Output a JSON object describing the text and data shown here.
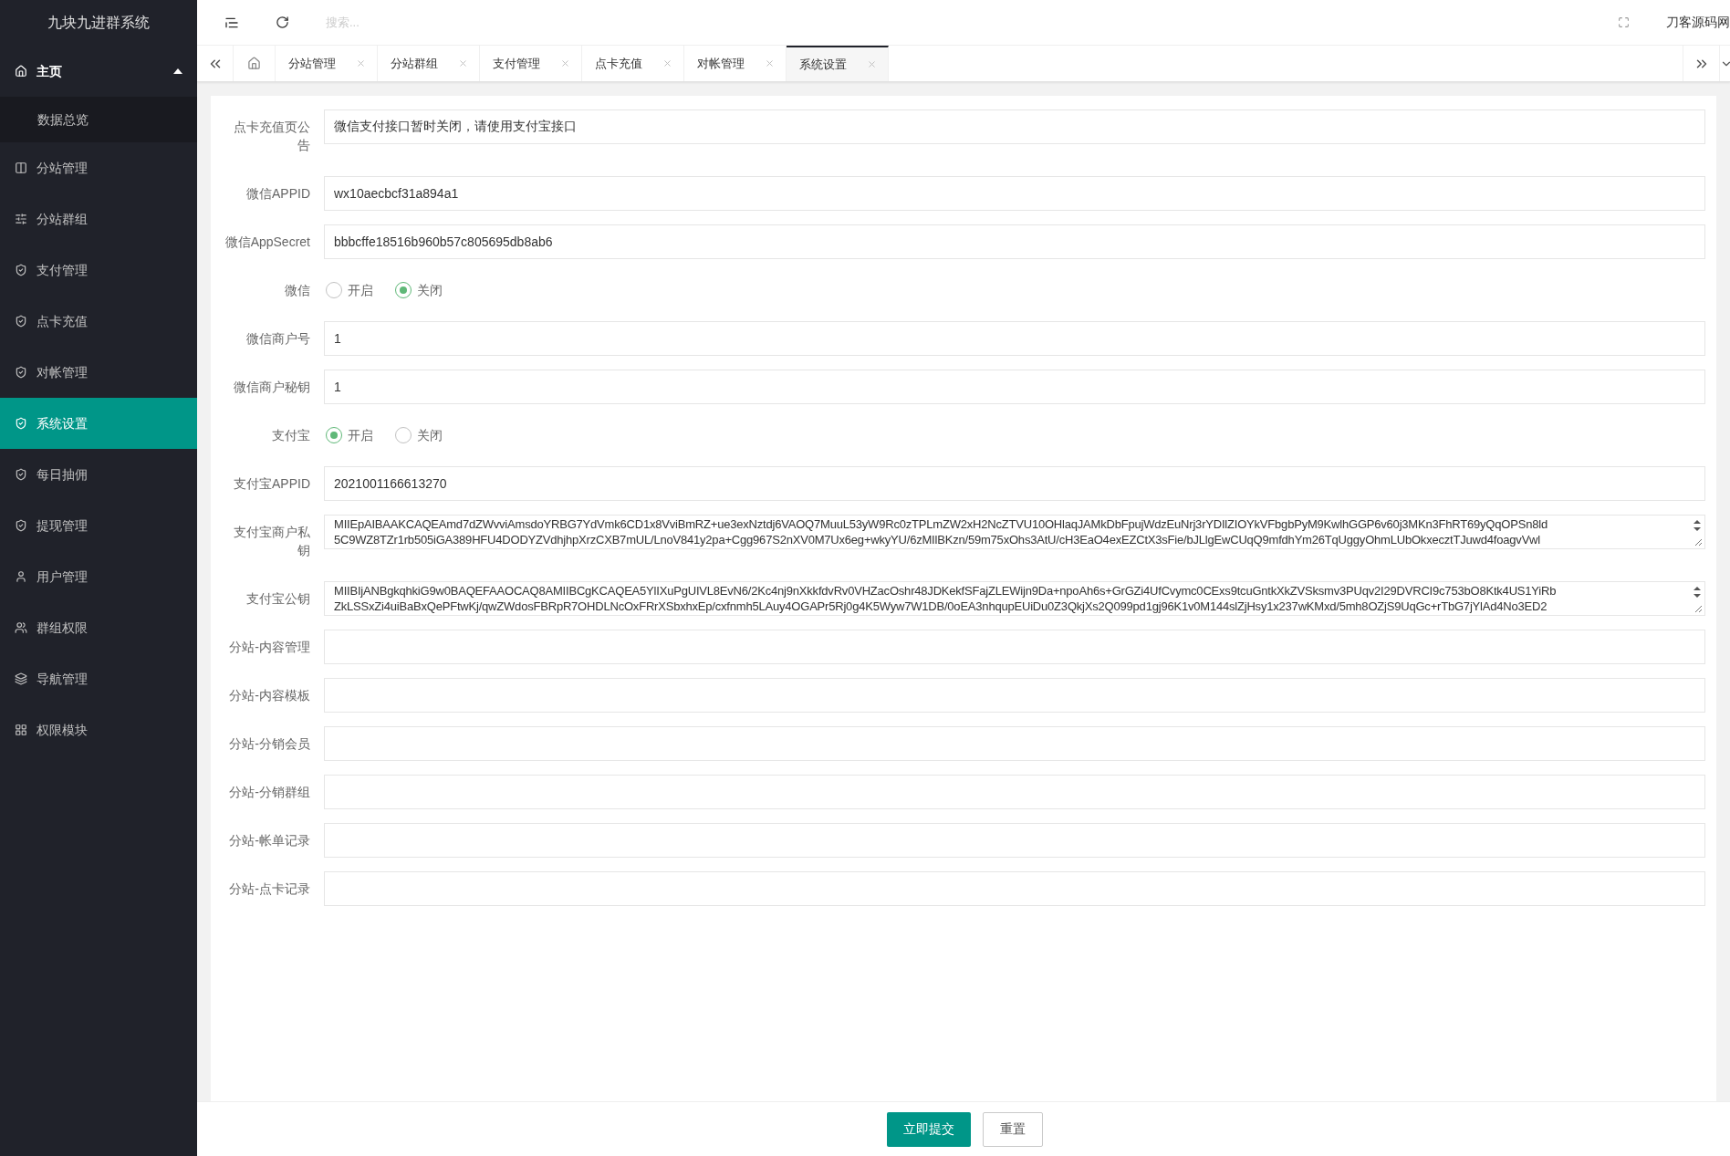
{
  "app_title": "九块九进群系统",
  "sidebar": {
    "items": [
      {
        "label": "主页",
        "expanded": true,
        "selected": false,
        "children": [
          {
            "label": "数据总览",
            "selected": false
          }
        ]
      },
      {
        "label": "分站管理",
        "selected": false
      },
      {
        "label": "分站群组",
        "selected": false
      },
      {
        "label": "支付管理",
        "selected": false
      },
      {
        "label": "点卡充值",
        "selected": false
      },
      {
        "label": "对帐管理",
        "selected": false
      },
      {
        "label": "系统设置",
        "selected": true
      },
      {
        "label": "每日抽佣",
        "selected": false
      },
      {
        "label": "提现管理",
        "selected": false
      },
      {
        "label": "用户管理",
        "selected": false
      },
      {
        "label": "群组权限",
        "selected": false
      },
      {
        "label": "导航管理",
        "selected": false
      },
      {
        "label": "权限模块",
        "selected": false
      }
    ]
  },
  "header": {
    "search": {
      "placeholder": "搜索..."
    },
    "user": "刀客源码网"
  },
  "tabs": [
    {
      "label": "分站管理",
      "selected": false
    },
    {
      "label": "分站群组",
      "selected": false
    },
    {
      "label": "支付管理",
      "selected": false
    },
    {
      "label": "点卡充值",
      "selected": false
    },
    {
      "label": "对帐管理",
      "selected": false
    },
    {
      "label": "系统设置",
      "selected": true
    }
  ],
  "form": {
    "fields": [
      {
        "kind": "text",
        "label": "点卡充值页公告",
        "value": "微信支付接口暂时关闭，请使用支付宝接口"
      },
      {
        "kind": "text",
        "label": "微信APPID",
        "value": "wx10aecbcf31a894a1"
      },
      {
        "kind": "text",
        "label": "微信AppSecret",
        "value": "bbbcffe18516b960b57c805695db8ab6"
      },
      {
        "kind": "radio",
        "label": "微信",
        "options": [
          {
            "label": "开启",
            "selected": false
          },
          {
            "label": "关闭",
            "selected": true
          }
        ]
      },
      {
        "kind": "text",
        "label": "微信商户号",
        "value": "1"
      },
      {
        "kind": "text",
        "label": "微信商户秘钥",
        "value": "1"
      },
      {
        "kind": "radio",
        "label": "支付宝",
        "options": [
          {
            "label": "开启",
            "selected": true
          },
          {
            "label": "关闭",
            "selected": false
          }
        ]
      },
      {
        "kind": "text",
        "label": "支付宝APPID",
        "value": "2021001166613270"
      },
      {
        "kind": "textarea",
        "label": "支付宝商户私钥",
        "lines": [
          "MIIEpAIBAAKCAQEAmd7dZWvviAmsdoYRBG7YdVmk6CD1x8VviBmRZ+ue3exNztdj6VAOQ7MuuL53yW9Rc0zTPLmZW2xH2NcZTVU10OHlaqJAMkDbFpujWdzEuNrj3rYDIlZIOYkVFbgbPyM9KwlhGGP6v60j3MKn3FhRT69yQqOPSn8ld",
          "5C9WZ8TZr1rb505iGA389HFU4DODYZVdhjhpXrzCXB7mUL/LnoV841y2pa+Cgg967S2nXV0M7Ux6eg+wkyYU/6zMIlBKzn/59m75xOhs3AtU/cH3EaO4exEZCtX3sFie/bJLlgEwCUqQ9mfdhYm26TqUggyOhmLUbOkxecztTJuwd4foagvVwl"
        ]
      },
      {
        "kind": "textarea",
        "label": "支付宝公钥",
        "lines": [
          "MIIBIjANBgkqhkiG9w0BAQEFAAOCAQ8AMIIBCgKCAQEA5YlIXuPgUIVL8EvN6/2Kc4nj9nXkkfdvRv0VHZacOshr48JDKekfSFajZLEWijn9Da+npoAh6s+GrGZi4UfCvymc0CExs9tcuGntkXkZVSksmv3PUqv2I29DVRCI9c753bO8Ktk4US1YiRb",
          "ZkLSSxZi4uiBaBxQePFtwKj/qwZWdosFBRpR7OHDLNcOxFRrXSbxhxEp/cxfnmh5LAuy4OGAPr5Rj0g4K5Wyw7W1DB/0oEA3nhqupEUiDu0Z3QkjXs2Q099pd1gj96K1v0M144slZjHsy1x237wKMxd/5mh8OZjS9UqGc+rTbG7jYlAd4No3ED2"
        ]
      },
      {
        "kind": "text",
        "label": "分站-内容管理"
      },
      {
        "kind": "text",
        "label": "分站-内容模板"
      },
      {
        "kind": "text",
        "label": "分站-分销会员"
      },
      {
        "kind": "text",
        "label": "分站-分销群组"
      },
      {
        "kind": "text",
        "label": "分站-帐单记录"
      },
      {
        "kind": "text",
        "label": "分站-点卡记录"
      }
    ]
  },
  "buttons": {
    "submit": "立即提交",
    "reset": "重置"
  }
}
